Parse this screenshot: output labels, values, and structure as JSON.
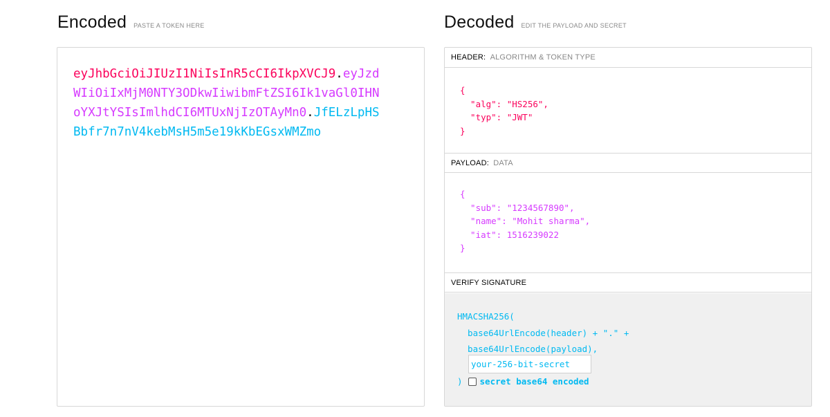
{
  "encoded": {
    "title": "Encoded",
    "subtitle": "PASTE A TOKEN HERE",
    "token": {
      "header": "eyJhbGciOiJIUzI1NiIsInR5cCI6IkpXVCJ9",
      "payload": "eyJzdWIiOiIxMjM0NTY3ODkwIiwibmFtZSI6Ik1vaGl0IHNoYXJtYSIsImlhdCI6MTUxNjIzOTAyMn0",
      "signature": "JfELzLpHSBbfr7n7nV4kebMsH5m5e19kKbEGsxWMZmo",
      "dot": "."
    }
  },
  "decoded": {
    "title": "Decoded",
    "subtitle": "EDIT THE PAYLOAD AND SECRET",
    "header_section": {
      "label": "HEADER:",
      "sublabel": "ALGORITHM & TOKEN TYPE",
      "json": "{\n  \"alg\": \"HS256\",\n  \"typ\": \"JWT\"\n}"
    },
    "payload_section": {
      "label": "PAYLOAD:",
      "sublabel": "DATA",
      "json": "{\n  \"sub\": \"1234567890\",\n  \"name\": \"Mohit sharma\",\n  \"iat\": 1516239022\n}"
    },
    "signature_section": {
      "label": "VERIFY SIGNATURE",
      "code": "HMACSHA256(\n  base64UrlEncode(header) + \".\" +\n  base64UrlEncode(payload),",
      "secret_placeholder": "your-256-bit-secret",
      "close_paren": ")",
      "base64_label": "secret base64 encoded"
    }
  },
  "colors": {
    "header": "#fb015b",
    "payload": "#d63aff",
    "signature": "#00b9f1"
  }
}
